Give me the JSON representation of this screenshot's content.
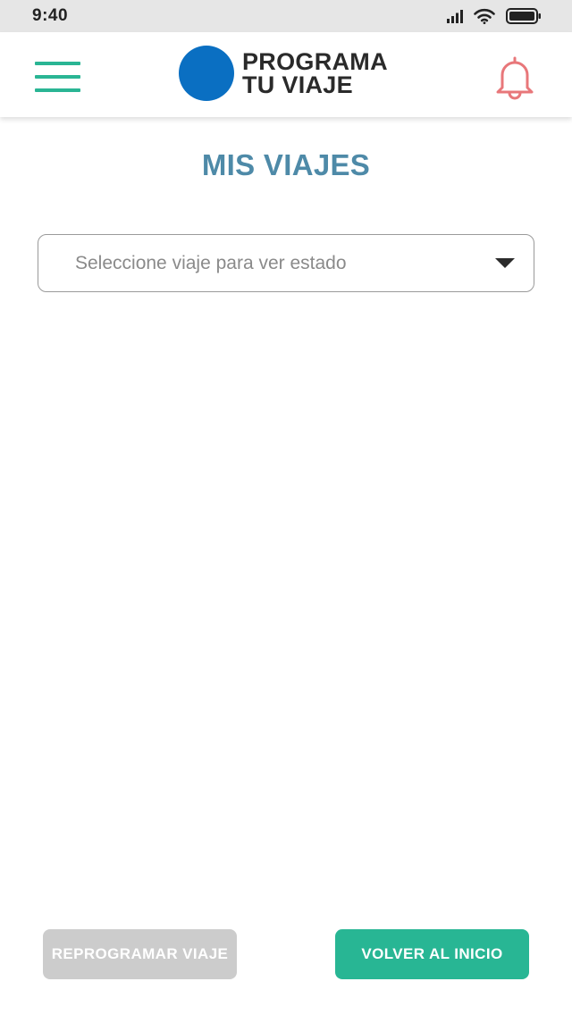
{
  "status_bar": {
    "time": "9:40",
    "icons": [
      "cellular-signal-icon",
      "wifi-icon",
      "battery-icon"
    ]
  },
  "header": {
    "menu_icon": "hamburger-menu-icon",
    "logo": {
      "line1": "PROGRAMA",
      "line2": "TU VIAJE",
      "circle_color": "#0a6fc2"
    },
    "bell_icon": "bell-icon",
    "bell_color": "#e8777a"
  },
  "main": {
    "title": "MIS VIAJES",
    "trip_select": {
      "placeholder": "Seleccione viaje para ver estado",
      "arrow_icon": "caret-down-icon"
    }
  },
  "actions": {
    "reprogram_label": "REPROGRAMAR VIAJE",
    "reprogram_color": "#cccccc",
    "home_label": "VOLVER AL INICIO",
    "home_color": "#28b694"
  },
  "colors": {
    "accent": "#2ab594",
    "title": "#4e8aa8"
  }
}
